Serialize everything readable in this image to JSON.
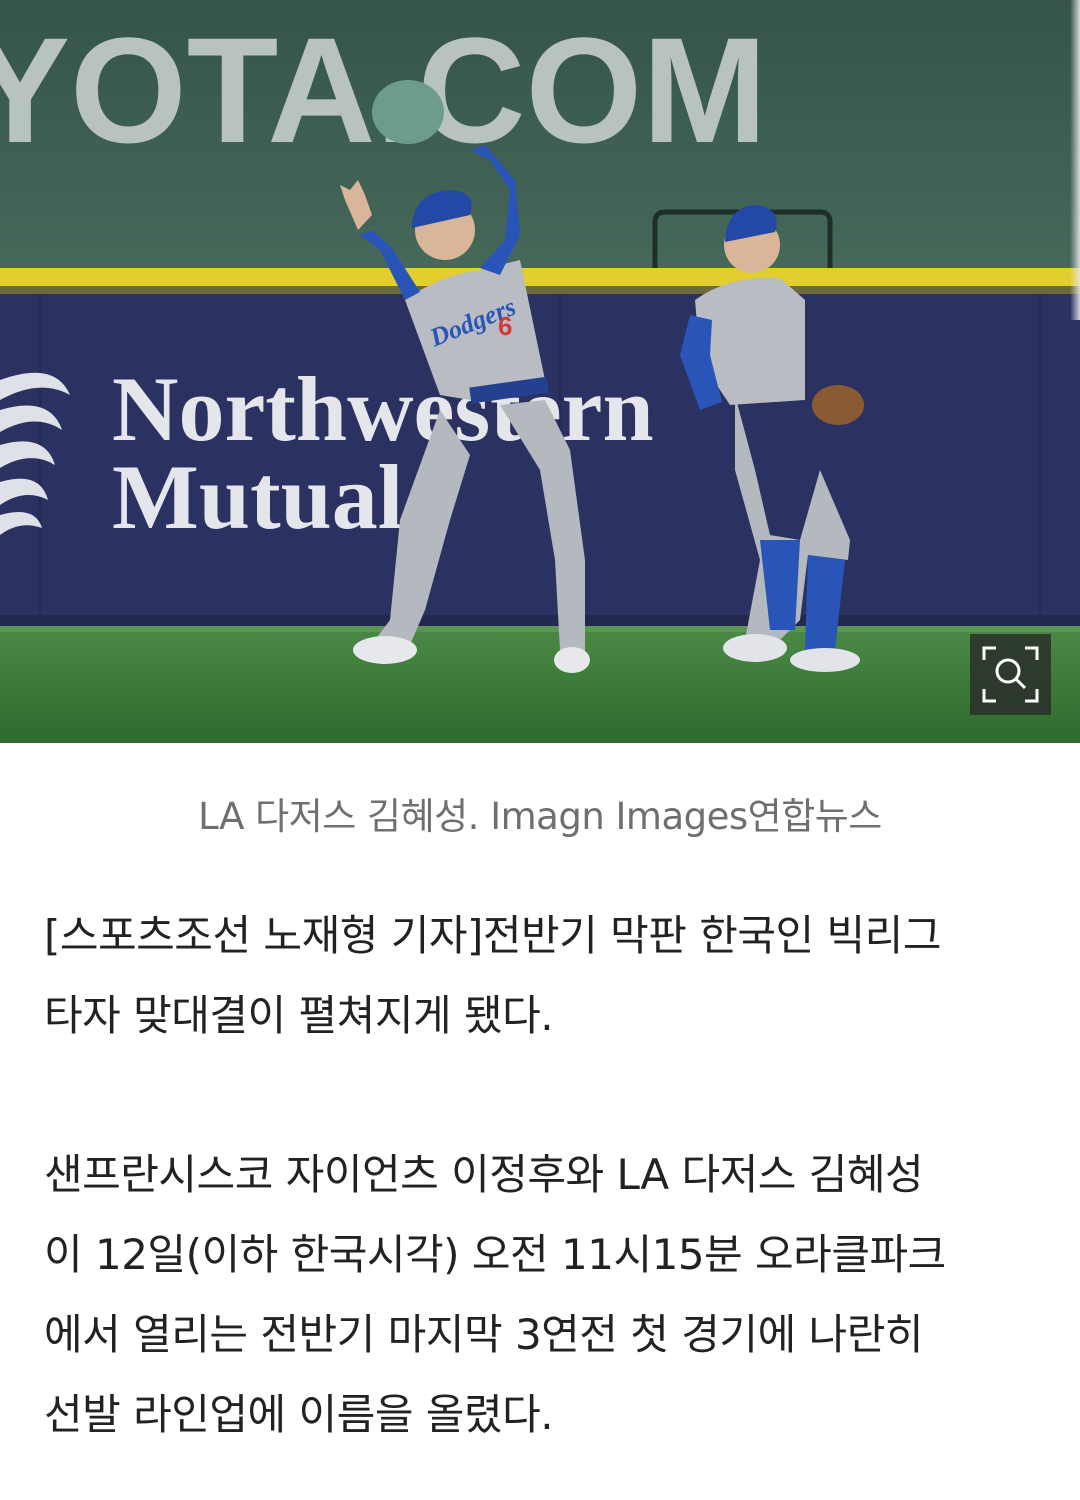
{
  "photo": {
    "alt_scene": "Two Dodgers outfielders catching a fly ball",
    "banner_text": "YOTA.COM",
    "ad_text_line1": "Northwestern",
    "ad_text_line2": "Mutual",
    "jersey_text": "Dodgers",
    "jersey_number": "6",
    "zoom_icon": "zoom-search-icon",
    "colors": {
      "wall": "#2c325f",
      "yellow_stripe": "#e8d32a",
      "grass": "#3f7d3a",
      "stands": "#3d5a4c",
      "dodger_blue": "#2a55b8",
      "uniform_gray": "#b9bcc2"
    }
  },
  "caption": "LA 다저스 김혜성. Imagn Images연합뉴스",
  "article": {
    "paragraph1": [
      "[스포츠조선 노재형 기자]전반기 막판 한국인 빅리그",
      "타자 맞대결이 펼쳐지게 됐다."
    ],
    "paragraph2": [
      "샌프란시스코 자이언츠 이정후와 LA 다저스 김혜성",
      "이 12일(이하 한국시각) 오전 11시15분 오라클파크",
      "에서 열리는 전반기 마지막 3연전 첫 경기에 나란히",
      "선발 라인업에 이름을 올렸다."
    ]
  }
}
